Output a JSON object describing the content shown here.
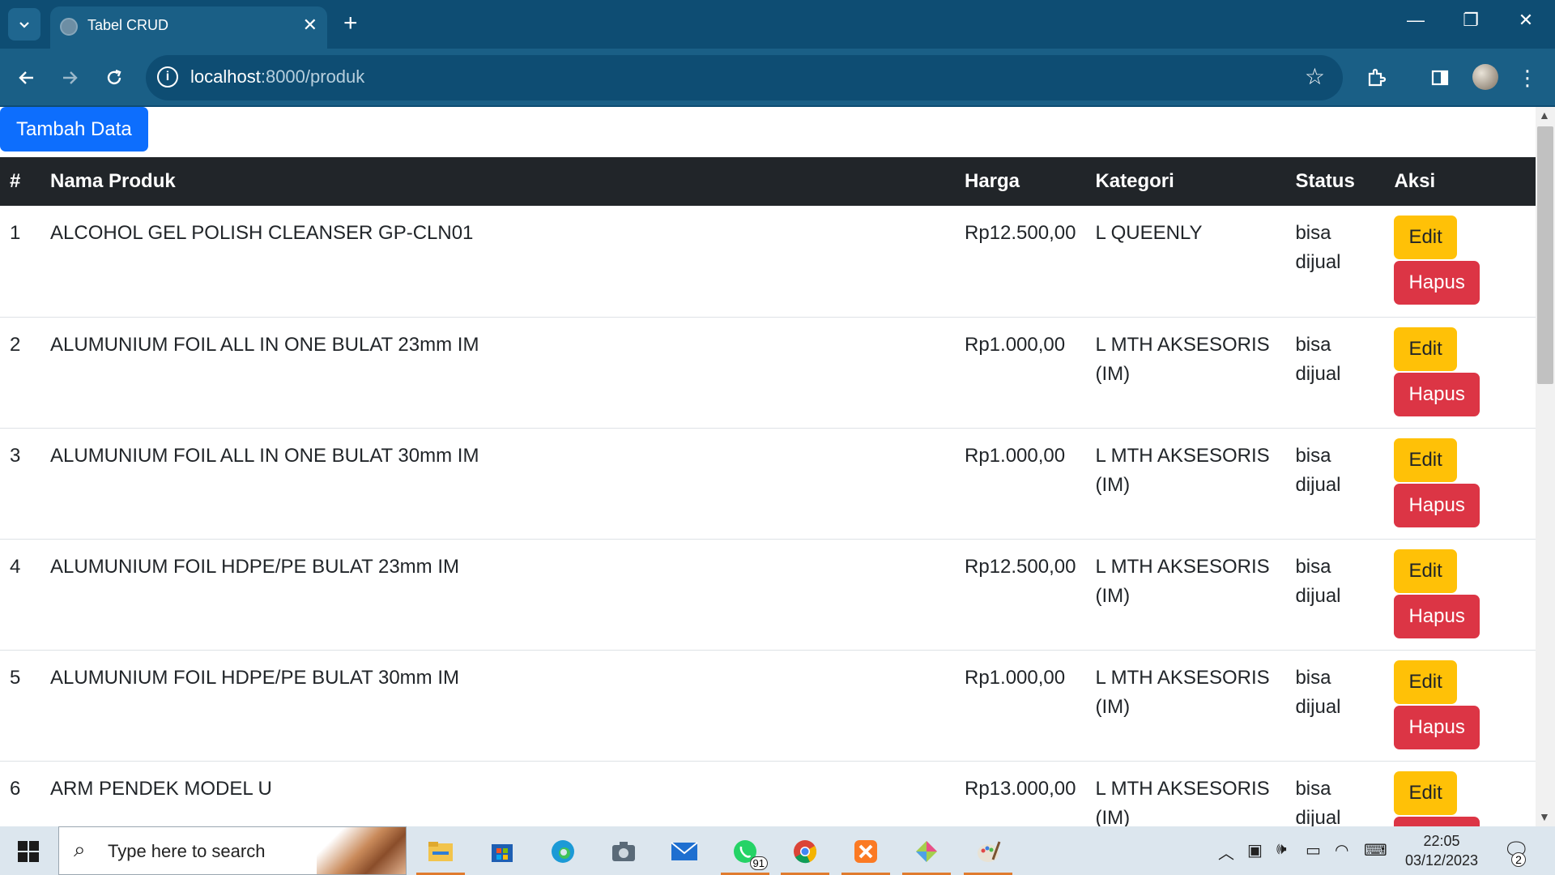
{
  "browser": {
    "tab_title": "Tabel CRUD",
    "url_host": "localhost",
    "url_path": ":8000/produk"
  },
  "page": {
    "add_button": "Tambah Data",
    "columns": [
      "#",
      "Nama Produk",
      "Harga",
      "Kategori",
      "Status",
      "Aksi"
    ],
    "rows": [
      {
        "no": "1",
        "name": "ALCOHOL GEL POLISH CLEANSER GP-CLN01",
        "price": "Rp12.500,00",
        "category": "L QUEENLY",
        "status": "bisa dijual"
      },
      {
        "no": "2",
        "name": "ALUMUNIUM FOIL ALL IN ONE BULAT 23mm IM",
        "price": "Rp1.000,00",
        "category": "L MTH AKSESORIS (IM)",
        "status": "bisa dijual"
      },
      {
        "no": "3",
        "name": "ALUMUNIUM FOIL ALL IN ONE BULAT 30mm IM",
        "price": "Rp1.000,00",
        "category": "L MTH AKSESORIS (IM)",
        "status": "bisa dijual"
      },
      {
        "no": "4",
        "name": "ALUMUNIUM FOIL HDPE/PE BULAT 23mm IM",
        "price": "Rp12.500,00",
        "category": "L MTH AKSESORIS (IM)",
        "status": "bisa dijual"
      },
      {
        "no": "5",
        "name": "ALUMUNIUM FOIL HDPE/PE BULAT 30mm IM",
        "price": "Rp1.000,00",
        "category": "L MTH AKSESORIS (IM)",
        "status": "bisa dijual"
      },
      {
        "no": "6",
        "name": "ARM PENDEK MODEL U",
        "price": "Rp13.000,00",
        "category": "L MTH AKSESORIS (IM)",
        "status": "bisa dijual"
      }
    ],
    "edit_label": "Edit",
    "delete_label": "Hapus"
  },
  "taskbar": {
    "search_placeholder": "Type here to search",
    "whatsapp_badge": "91",
    "time": "22:05",
    "date": "03/12/2023",
    "notification_count": "2"
  },
  "colors": {
    "primary": "#0d6efd",
    "warning": "#ffc107",
    "danger": "#dc3545",
    "table_header": "#212529",
    "browser_frame": "#0e4d73"
  }
}
